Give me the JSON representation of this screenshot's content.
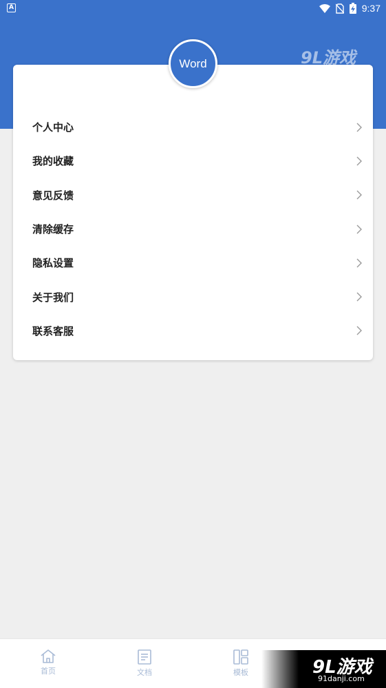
{
  "status_bar": {
    "left_badge": "A",
    "time": "9:37"
  },
  "header": {
    "avatar_text": "Word",
    "brand_color": "#3a72cb"
  },
  "watermark": {
    "brand": "9L游戏",
    "domain": "91danji.com"
  },
  "menu": {
    "items": [
      {
        "label": "个人中心",
        "icon": "chevron-right-icon"
      },
      {
        "label": "我的收藏",
        "icon": "chevron-right-icon"
      },
      {
        "label": "意见反馈",
        "icon": "chevron-right-icon"
      },
      {
        "label": "清除缓存",
        "icon": "chevron-right-icon"
      },
      {
        "label": "隐私设置",
        "icon": "chevron-right-icon"
      },
      {
        "label": "关于我们",
        "icon": "chevron-right-icon"
      },
      {
        "label": "联系客服",
        "icon": "chevron-right-icon"
      }
    ]
  },
  "bottom_nav": {
    "items": [
      {
        "label": "首页",
        "icon": "home-icon"
      },
      {
        "label": "文档",
        "icon": "document-icon"
      },
      {
        "label": "模板",
        "icon": "template-icon"
      }
    ]
  }
}
